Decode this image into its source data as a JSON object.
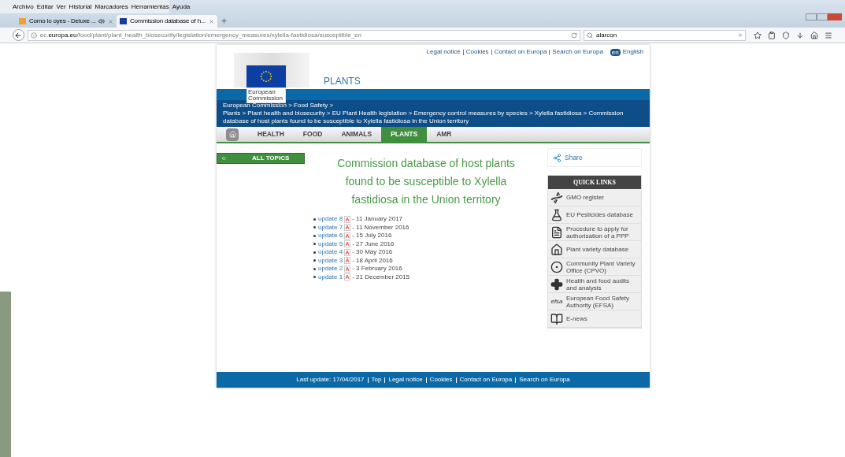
{
  "browser": {
    "menu": [
      "Archivo",
      "Editar",
      "Ver",
      "Historial",
      "Marcadores",
      "Herramientas",
      "Ayuda"
    ],
    "tabs": [
      {
        "title": "Como lo oyes - Deluxe ...",
        "selected": false,
        "audio": true
      },
      {
        "title": "Commission database of h...",
        "selected": true,
        "audio": false
      }
    ],
    "url": {
      "host_prefix": "ec.",
      "host": "europa.eu",
      "path": "/food/plant/plant_health_biosecurity/legislation/emergency_measures/xylella-fastidiosa/susceptible_en"
    },
    "search": "alarcon"
  },
  "page": {
    "top_links": [
      "Legal notice",
      "Cookies",
      "Contact on Europa",
      "Search on Europa"
    ],
    "language": {
      "code": "en",
      "name": "English"
    },
    "logo_text": "European Commission",
    "site_title": "PLANTS",
    "breadcrumb": [
      "European Commission > Food Safety >",
      "Plants > Plant health and biosecurity > EU Plant Health legislation > Emergency control measures by species > Xylella fastidiosa > Commission database of host plants found to be susceptible to Xylella fastidiosa in the Union territory"
    ],
    "nav": [
      {
        "label": "HEALTH",
        "selected": false
      },
      {
        "label": "FOOD",
        "selected": false
      },
      {
        "label": "ANIMALS",
        "selected": false
      },
      {
        "label": "PLANTS",
        "selected": true
      },
      {
        "label": "AMR",
        "selected": false
      }
    ],
    "all_topics": "ALL TOPICS",
    "heading": "Commission database of host plants found to be susceptible to Xylella fastidiosa in the Union territory",
    "updates": [
      {
        "link": "update 8",
        "date": "- 11 January 2017"
      },
      {
        "link": "update 7",
        "date": "- 11 November 2016"
      },
      {
        "link": "update 6",
        "date": "- 15 July 2016"
      },
      {
        "link": "update 5",
        "date": "- 27 June 2016"
      },
      {
        "link": "update 4",
        "date": "- 30 May 2016"
      },
      {
        "link": "update 3",
        "date": "- 18 April 2016"
      },
      {
        "link": "update 2",
        "date": "- 3 February 2016"
      },
      {
        "link": "update 1",
        "date": "- 21 December 2015"
      }
    ],
    "share": "Share",
    "quick_links": {
      "title": "QUICK LINKS",
      "items": [
        {
          "kind": "dna",
          "label": "GMO register"
        },
        {
          "kind": "flask",
          "label": "EU Pesticides database"
        },
        {
          "kind": "document",
          "label": "Procedure to apply for authorisation of a PPP"
        },
        {
          "kind": "house",
          "label": "Plant variety database"
        },
        {
          "kind": "circle",
          "label": "Community Plant Variety Office (CPVO)"
        },
        {
          "kind": "cross",
          "label": "Health and food audits and analysis"
        },
        {
          "kind": "efsa",
          "label": "European Food Safety Authority (EFSA)",
          "icon_text": "efsa"
        },
        {
          "kind": "reader",
          "label": "E-news"
        }
      ]
    },
    "footer": {
      "last_update": "Last update: 17/04/2017",
      "links": [
        "Top",
        "Legal notice",
        "Cookies",
        "Contact on Europa",
        "Search on Europa"
      ]
    }
  }
}
